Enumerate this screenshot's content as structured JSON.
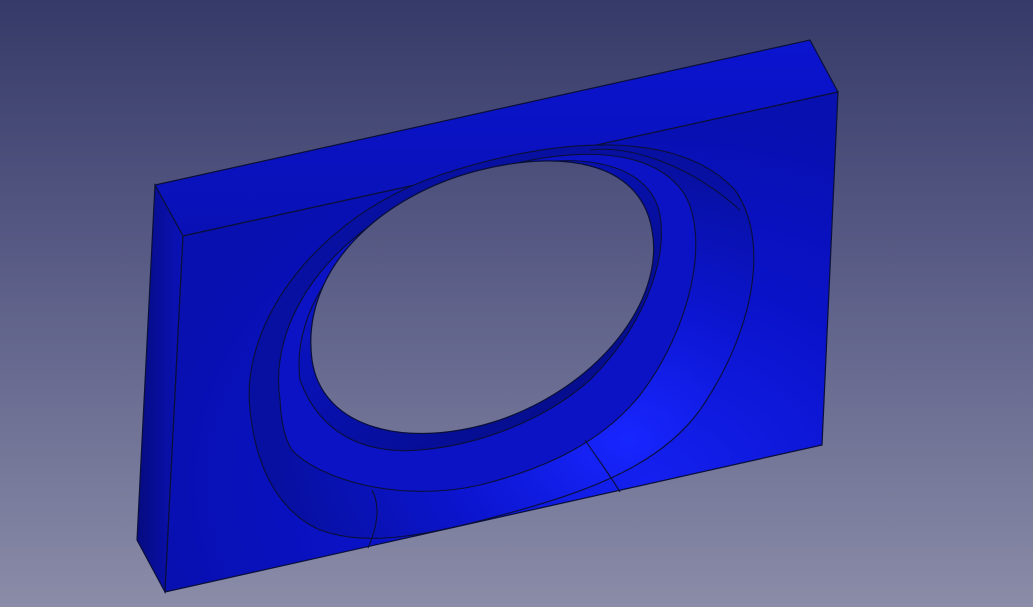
{
  "viewport": {
    "background_top": "#363a68",
    "background_bottom": "#8a8ca8"
  },
  "model": {
    "part_color": "#0a12c8",
    "part_shadow_color": "#050c88",
    "highlight_color": "#1722f2",
    "edge_color": "#0a0f3a"
  }
}
